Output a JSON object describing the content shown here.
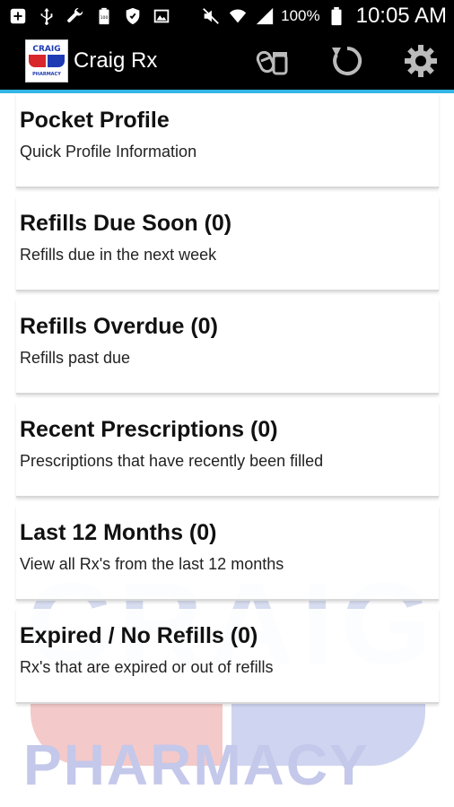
{
  "status_bar": {
    "left_icons": [
      "add-icon",
      "usb-icon",
      "wrench-icon",
      "battery-100-icon",
      "shield-icon",
      "image-icon"
    ],
    "right_icons": [
      "mute-icon",
      "wifi-icon",
      "signal-icon",
      "battery-icon"
    ],
    "battery_pct": "100%",
    "time": "10:05 AM"
  },
  "action_bar": {
    "title": "Craig Rx",
    "logo_text_top": "CRAIG",
    "logo_text_bottom": "PHARMACY",
    "actions": [
      "pill-icon",
      "refresh-icon",
      "settings-icon"
    ]
  },
  "menu": [
    {
      "title": "Pocket Profile",
      "subtitle": "Quick Profile Information"
    },
    {
      "title": "Refills Due Soon (0)",
      "subtitle": "Refills due in the next week"
    },
    {
      "title": "Refills Overdue (0)",
      "subtitle": "Refills past due"
    },
    {
      "title": "Recent Prescriptions (0)",
      "subtitle": "Prescriptions that have recently been filled"
    },
    {
      "title": "Last 12 Months (0)",
      "subtitle": "View all Rx's from the last 12 months"
    },
    {
      "title": "Expired / No Refills (0)",
      "subtitle": "Rx's that are expired or out of refills"
    }
  ],
  "watermark": {
    "top": "CRAIG",
    "bottom": "PHARMACY"
  },
  "colors": {
    "accent": "#33b5e5",
    "brand_red": "#d9262b",
    "brand_blue": "#1f3bb3"
  }
}
